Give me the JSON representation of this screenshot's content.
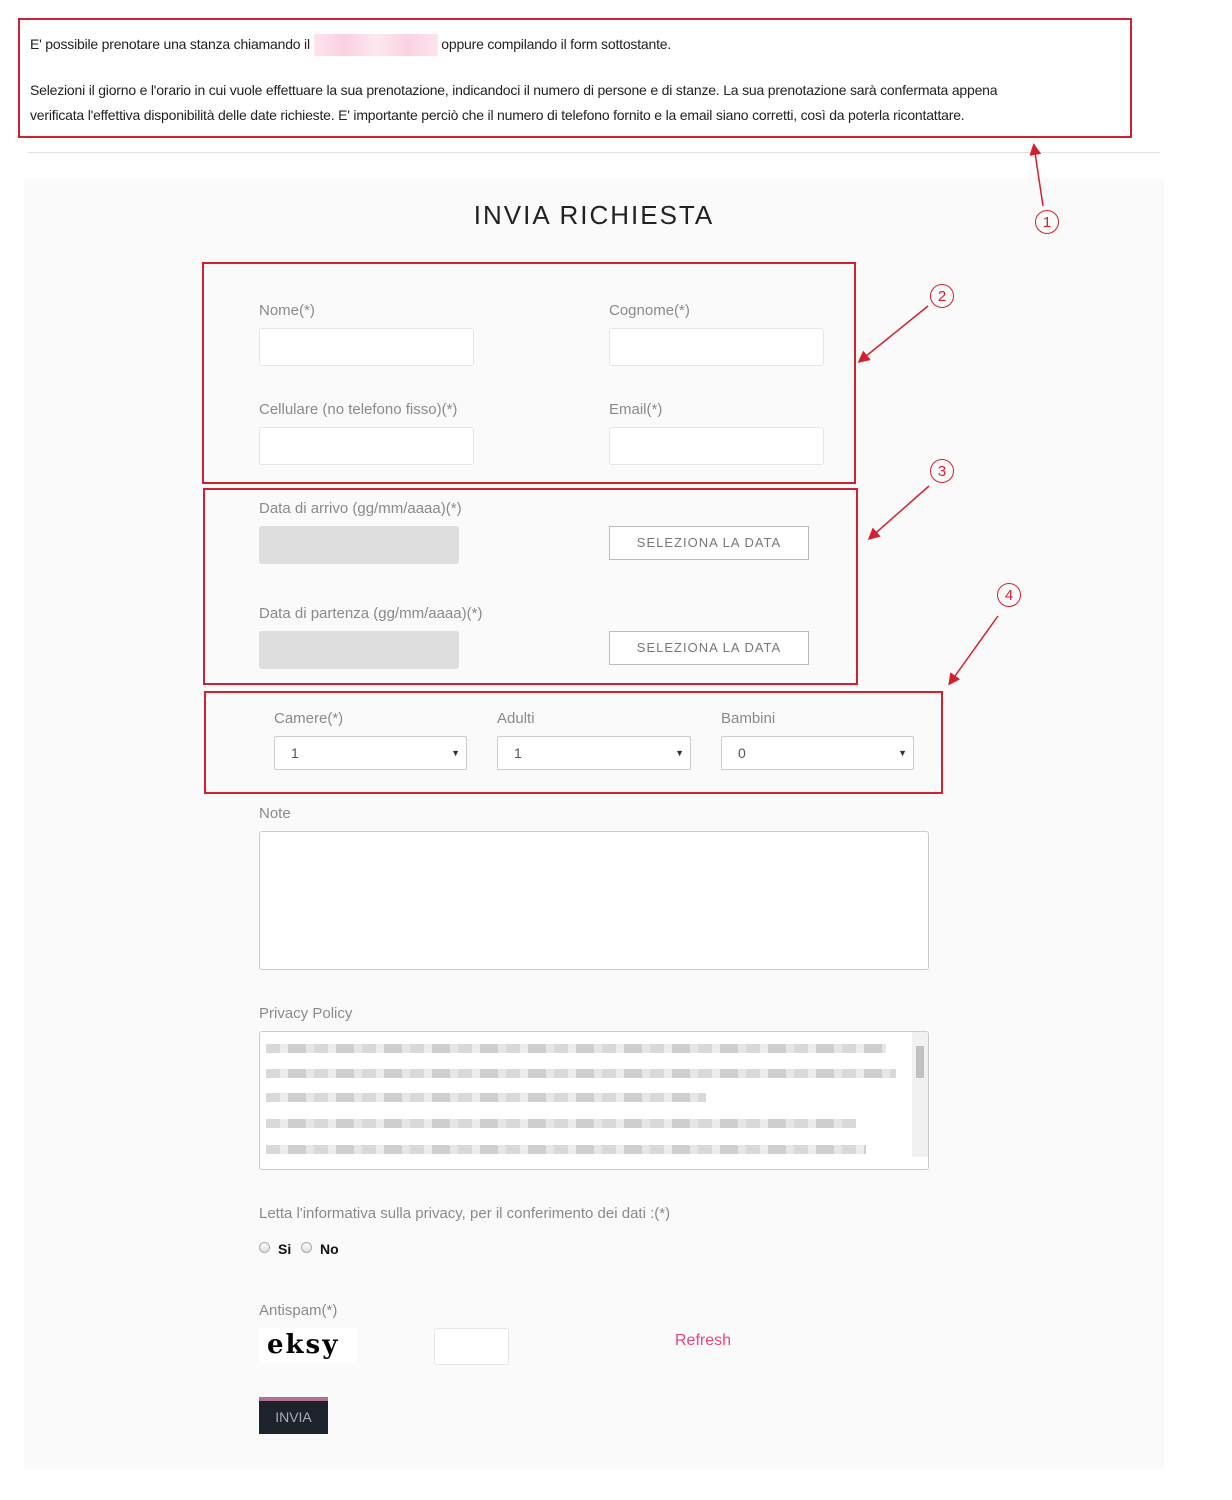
{
  "intro": {
    "line1_before": "E' possibile prenotare una stanza chiamando il",
    "line1_after": "oppure compilando il form sottostante.",
    "line2": "Selezioni il giorno e l'orario in cui vuole effettuare la sua prenotazione, indicandoci il numero di persone e di stanze. La sua prenotazione sarà confermata appena",
    "line3": "verificata l'effettiva disponibilità delle date richieste. E' importante perciò che il numero di telefono fornito e la email siano corretti, così da poterla ricontattare."
  },
  "form": {
    "title": "INVIA RICHIESTA",
    "nome_label": "Nome(*)",
    "cognome_label": "Cognome(*)",
    "cellulare_label": "Cellulare (no telefono fisso)(*)",
    "email_label": "Email(*)",
    "arrivo_label": "Data di arrivo (gg/mm/aaaa)(*)",
    "partenza_label": "Data di partenza (gg/mm/aaaa)(*)",
    "select_date_label": "SELEZIONA LA DATA",
    "camere_label": "Camere(*)",
    "camere_value": "1",
    "adulti_label": "Adulti",
    "adulti_value": "1",
    "bambini_label": "Bambini",
    "bambini_value": "0",
    "note_label": "Note",
    "privacy_label": "Privacy Policy",
    "consent_label": "Letta l'informativa sulla privacy, per il conferimento dei dati :(*)",
    "yes_label": "Si",
    "no_label": "No",
    "antispam_label": "Antispam(*)",
    "captcha_text": "eksy",
    "refresh_label": "Refresh",
    "submit_label": "INVIA"
  },
  "annotations": [
    "1",
    "2",
    "3",
    "4"
  ],
  "colors": {
    "annotation": "#d3202f",
    "link": "#e8457a",
    "submit_bg": "#1e232b",
    "submit_top": "#b07294"
  }
}
